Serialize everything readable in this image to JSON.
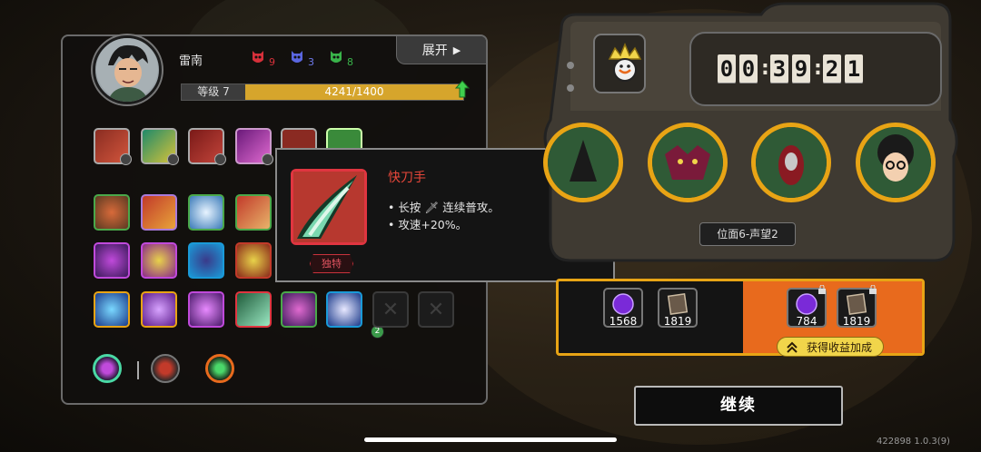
{
  "player": {
    "name": "雷南",
    "level_label": "等级 7",
    "xp_text": "4241/1400",
    "xp_progress": 1.0,
    "masks": [
      {
        "color": "#d6303a",
        "count": "9"
      },
      {
        "color": "#5a66e0",
        "count": "3"
      },
      {
        "color": "#39b34a",
        "count": "8"
      }
    ]
  },
  "expand_button": {
    "label": "展开"
  },
  "tooltip": {
    "title": "快刀手",
    "tag": "独特",
    "line1_prefix": "• 长按",
    "line1_suffix": "连续普攻。",
    "line2": "• 攻速+20%。"
  },
  "timer": {
    "digits": [
      "0",
      "0",
      "3",
      "9",
      "2",
      "1"
    ]
  },
  "stage_label": "位面6-声望2",
  "resources": {
    "base": [
      {
        "count": "1568",
        "kind": "purple-orb"
      },
      {
        "count": "1819",
        "kind": "scroll"
      }
    ],
    "bonus": [
      {
        "count": "784",
        "kind": "purple-orb"
      },
      {
        "count": "1819",
        "kind": "scroll"
      }
    ]
  },
  "bonus_label": "获得收益加成",
  "continue_button": {
    "label": "继续"
  },
  "version": "422898 1.0.3(9)",
  "skill_slot_badge": "2",
  "colors": {
    "accent": "#e8a415",
    "red": "#e8473a",
    "orange": "#e86a1d"
  }
}
